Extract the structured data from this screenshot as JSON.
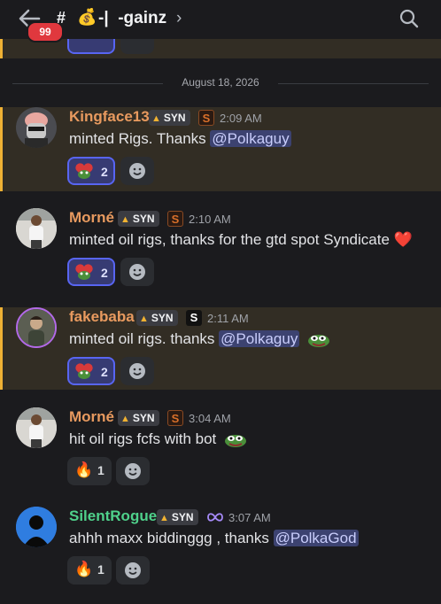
{
  "header": {
    "unread_count": "99",
    "hash": "#",
    "channel_emoji": "💰",
    "channel_name": "-|  -gainz",
    "chevron": "›"
  },
  "date_divider": "August 18, 2026",
  "colors": {
    "highlight_bg": "#322d24",
    "highlight_bar": "#efb134",
    "mention_bg": "#3c4270",
    "badge_red": "#e0383e"
  },
  "messages": [
    {
      "username": "Kingface13",
      "username_color": "#e89a5f",
      "badge": "SYN",
      "role_icon": "S",
      "time": "2:09 AM",
      "text": "minted Rigs. Thanks ",
      "mention": "@Polkaguy",
      "reaction_emoji": "heart-pepe",
      "reaction_count": "2",
      "highlighted": true
    },
    {
      "username": "Morné",
      "username_color": "#e89a5f",
      "badge": "SYN",
      "role_icon": "S",
      "time": "2:10 AM",
      "text": "minted oil rigs, thanks for the gtd spot Syndicate ",
      "trailing_emoji": "❤️",
      "reaction_emoji": "heart-pepe",
      "reaction_count": "2"
    },
    {
      "username": "fakebaba",
      "username_color": "#e89a5f",
      "badge": "SYN",
      "role_icon": "S",
      "time": "2:11 AM",
      "text": "minted oil rigs. thanks ",
      "mention": "@Polkaguy",
      "reaction_emoji": "heart-pepe",
      "reaction_count": "2",
      "highlighted": true
    },
    {
      "username": "Morné",
      "username_color": "#e89a5f",
      "badge": "SYN",
      "role_icon": "S",
      "time": "3:04 AM",
      "text": "hit oil rigs fcfs with bot",
      "reaction_emoji": "🔥",
      "reaction_count": "1"
    },
    {
      "username": "SilentRogue",
      "username_color": "#4fd18b",
      "badge": "SYN",
      "role_icon": "infinity",
      "time": "3:07 AM",
      "text": "ahhh maxx biddinggg , thanks ",
      "mention": "@PolkaGod",
      "reaction_emoji": "🔥",
      "reaction_count": "1"
    }
  ]
}
